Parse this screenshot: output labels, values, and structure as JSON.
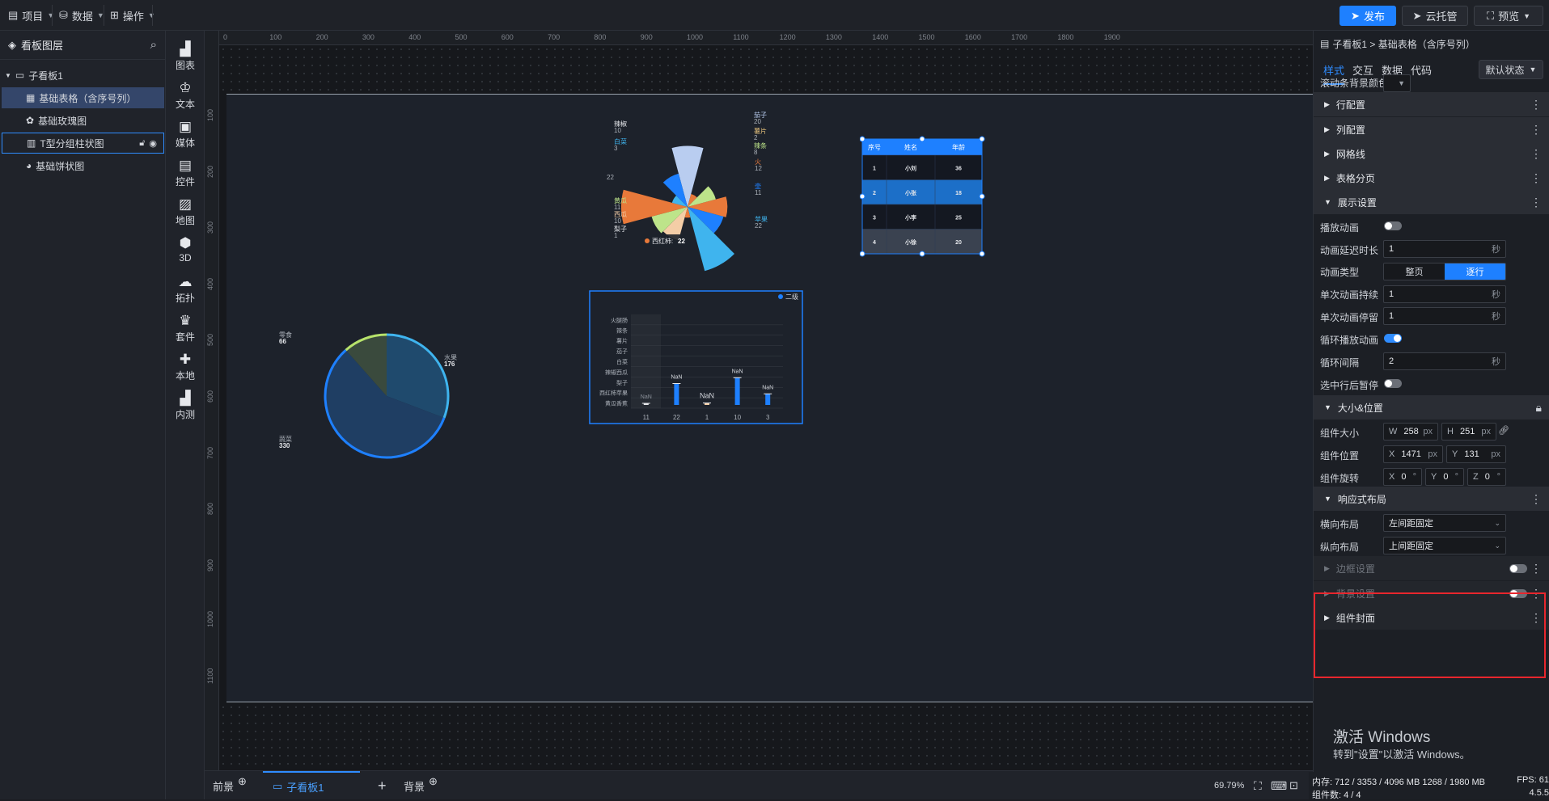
{
  "topbar": {
    "menus": [
      {
        "label": "项目"
      },
      {
        "label": "数据"
      },
      {
        "label": "操作"
      }
    ],
    "publish_label": "发布",
    "cloud_label": "云托管",
    "preview_label": "预览"
  },
  "layers": {
    "title": "看板图层",
    "root": "子看板1",
    "items": [
      {
        "label": "基础表格（含序号列）"
      },
      {
        "label": "基础玫瑰图"
      },
      {
        "label": "T型分组柱状图"
      },
      {
        "label": "基础饼状图"
      }
    ]
  },
  "iconbar": [
    {
      "label": "图表",
      "icon": "chart-icon"
    },
    {
      "label": "文本",
      "icon": "text-icon"
    },
    {
      "label": "媒体",
      "icon": "media-icon"
    },
    {
      "label": "控件",
      "icon": "control-icon"
    },
    {
      "label": "地图",
      "icon": "map-icon"
    },
    {
      "label": "3D",
      "icon": "cube-icon"
    },
    {
      "label": "拓扑",
      "icon": "topology-icon"
    },
    {
      "label": "套件",
      "icon": "suite-icon"
    },
    {
      "label": "本地",
      "icon": "puzzle-icon"
    },
    {
      "label": "内测",
      "icon": "beta-icon"
    }
  ],
  "ruler": {
    "h": [
      "0",
      "100",
      "200",
      "300",
      "400",
      "500",
      "600",
      "700",
      "800",
      "900",
      "1000",
      "1100",
      "1200",
      "1300",
      "1400",
      "1500",
      "1600",
      "1700",
      "1800",
      "1900"
    ],
    "v": [
      "100",
      "200",
      "300",
      "400",
      "500",
      "600",
      "700",
      "800",
      "900",
      "1000",
      "1100"
    ]
  },
  "chart_data": [
    {
      "type": "pie",
      "slices": [
        {
          "label": "水果",
          "value": 176
        },
        {
          "label": "蔬菜",
          "value": 330
        },
        {
          "label": "零食",
          "value": 66
        }
      ],
      "labels": [
        {
          "name": "零食",
          "value": "66"
        },
        {
          "name": "水果",
          "value": "176"
        },
        {
          "name": "蔬菜",
          "value": "330"
        }
      ]
    },
    {
      "type": "pie",
      "variant": "rose",
      "slices": [
        {
          "label": "茄子",
          "value": 20
        },
        {
          "label": "薯片",
          "value": 2
        },
        {
          "label": "辣条",
          "value": 8
        },
        {
          "label": "火",
          "value": 12
        },
        {
          "label": "壶",
          "value": 11
        },
        {
          "label": "苹果",
          "value": 22
        },
        {
          "label": "梨子",
          "value": 1
        },
        {
          "label": "西瓜",
          "value": 10
        },
        {
          "label": "黄瓜",
          "value": 11
        },
        {
          "label": "",
          "value": 22
        },
        {
          "label": "白菜",
          "value": 3
        },
        {
          "label": "辣椒",
          "value": 10
        }
      ],
      "labels": [
        {
          "name": "辣椒",
          "value": "10"
        },
        {
          "name": "白菜",
          "value": "3"
        },
        {
          "name": "",
          "value": "22"
        },
        {
          "name": "黄瓜",
          "value": "11"
        },
        {
          "name": "西瓜",
          "value": "10"
        },
        {
          "name": "梨子",
          "value": "1"
        },
        {
          "name": "茄子",
          "value": "20"
        },
        {
          "name": "薯片",
          "value": "2"
        },
        {
          "name": "辣条",
          "value": "8"
        },
        {
          "name": "火",
          "value": "12"
        },
        {
          "name": "壶",
          "value": "11"
        },
        {
          "name": "苹果",
          "value": "22"
        }
      ],
      "tooltip": {
        "name": "西红柿",
        "value": "22"
      }
    },
    {
      "type": "bar",
      "legend": "二级",
      "categories": [
        "黄瓜香蕉",
        "西红柿苹果",
        "梨子",
        "辣椒西瓜",
        "白菜",
        "茄子",
        "薯片",
        "辣条",
        "火腿肠"
      ],
      "x": [
        "11",
        "22",
        "1",
        "10",
        "3"
      ],
      "values": [
        0,
        22,
        1,
        10,
        3
      ],
      "data_labels": [
        "NaN",
        "NaN",
        "NaN",
        "NaN",
        "NaN"
      ]
    },
    {
      "type": "table",
      "headers": [
        "序号",
        "姓名",
        "年龄"
      ],
      "rows": [
        [
          "1",
          "小刘",
          "36"
        ],
        [
          "2",
          "小张",
          "18"
        ],
        [
          "3",
          "小李",
          "25"
        ],
        [
          "4",
          "小徐",
          "20"
        ]
      ]
    }
  ],
  "bottombar": {
    "tabs": [
      {
        "label": "前景"
      },
      {
        "label": "子看板1"
      },
      {
        "label": "背景"
      }
    ],
    "zoom": "69.79%"
  },
  "rightpanel": {
    "breadcrumb": "子看板1 > 基础表格（含序号列）",
    "tabs": [
      {
        "label": "样式"
      },
      {
        "label": "交互"
      },
      {
        "label": "数据"
      },
      {
        "label": "代码"
      }
    ],
    "state": "默认状态",
    "scroll_bg_label": "滚动条背景颜色",
    "sections": {
      "row_config": "行配置",
      "col_config": "列配置",
      "grid": "网格线",
      "paging": "表格分页",
      "display": "展示设置",
      "size_pos": "大小&位置",
      "responsive": "响应式布局",
      "border": "边框设置",
      "background": "背景设置",
      "component_shadow": "组件封面"
    },
    "display": {
      "play_anim": "播放动画",
      "anim_delay": "动画延迟时长",
      "anim_delay_value": "1",
      "anim_type": "动画类型",
      "anim_type_options": [
        "整页",
        "逐行"
      ],
      "single_duration": "单次动画持续",
      "single_duration_value": "1",
      "single_pause": "单次动画停留",
      "single_pause_value": "1",
      "loop": "循环播放动画",
      "loop_interval": "循环间隔",
      "loop_interval_value": "2",
      "pause_on_select": "选中行后暂停",
      "unit_sec": "秒"
    },
    "size": {
      "label": "组件大小",
      "w_prefix": "W",
      "w": "258",
      "h_prefix": "H",
      "h": "251",
      "px": "px",
      "pos_label": "组件位置",
      "x_prefix": "X",
      "x": "1471",
      "y_prefix": "Y",
      "y": "131",
      "rot_label": "组件旋转",
      "rx": "0",
      "ry": "0",
      "rz": "0",
      "z_prefix": "Z",
      "deg": "°"
    },
    "responsive": {
      "h_label": "横向布局",
      "h_value": "左间距固定",
      "v_label": "纵向布局",
      "v_value": "上间距固定"
    }
  },
  "watermark": {
    "line1": "激活 Windows",
    "line2": "转到\"设置\"以激活 Windows。"
  },
  "status": {
    "memory": "内存:  712 / 3353 / 4096 MB  1268 / 1980 MB",
    "fps": "FPS:  61",
    "components": "组件数: 4 / 4",
    "version": "4.5.5"
  },
  "colors": {
    "accent": "#1e80ff",
    "red_box": "#e8262d",
    "pie_main": "#1f4d73",
    "rose_blue": "#3fb4ee",
    "rose_orange": "#e8793a"
  }
}
